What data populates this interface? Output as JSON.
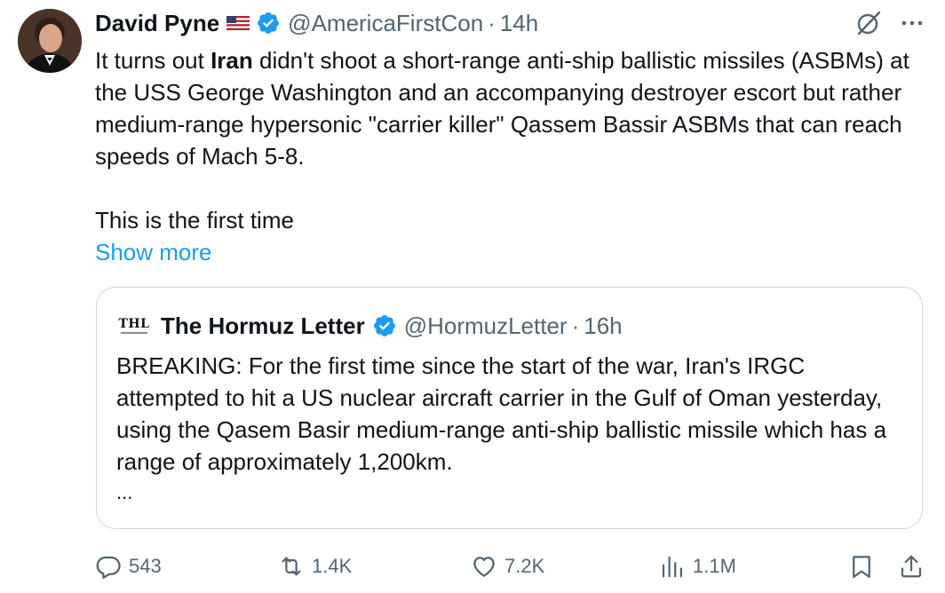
{
  "author": {
    "name": "David Pyne",
    "handle": "@AmericaFirstCon",
    "separator": "·",
    "time": "14h"
  },
  "body": {
    "line1_prefix": "It turns out ",
    "line1_bold": "Iran",
    "line1_rest": " didn't shoot a short-range anti-ship ballistic missiles (ASBMs) at the USS George Washington and an accompanying destroyer escort but rather medium-range hypersonic \"carrier killer\" Qassem Bassir ASBMs that can reach speeds of Mach 5-8.",
    "line2": "This is the first time",
    "show_more": "Show more"
  },
  "quote": {
    "logo_text": "THL",
    "name": "The Hormuz Letter",
    "handle": "@HormuzLetter",
    "separator": "·",
    "time": "16h",
    "text": "BREAKING: For the first time since the start of the war, Iran's IRGC attempted to hit a US nuclear aircraft carrier in the Gulf of Oman yesterday, using the Qasem Basir medium-range anti-ship ballistic missile which has a range of approximately 1,200km.",
    "ellipsis": "..."
  },
  "actions": {
    "replies": "543",
    "reposts": "1.4K",
    "likes": "7.2K",
    "views": "1.1M"
  },
  "colors": {
    "accent": "#1d9bf0",
    "text": "#0f1419",
    "muted": "#536471",
    "border": "#cfd9de"
  },
  "icons": [
    "grok-icon",
    "more-icon",
    "verified-icon",
    "us-flag-icon",
    "reply-icon",
    "retweet-icon",
    "like-icon",
    "views-icon",
    "bookmark-icon",
    "share-icon"
  ]
}
